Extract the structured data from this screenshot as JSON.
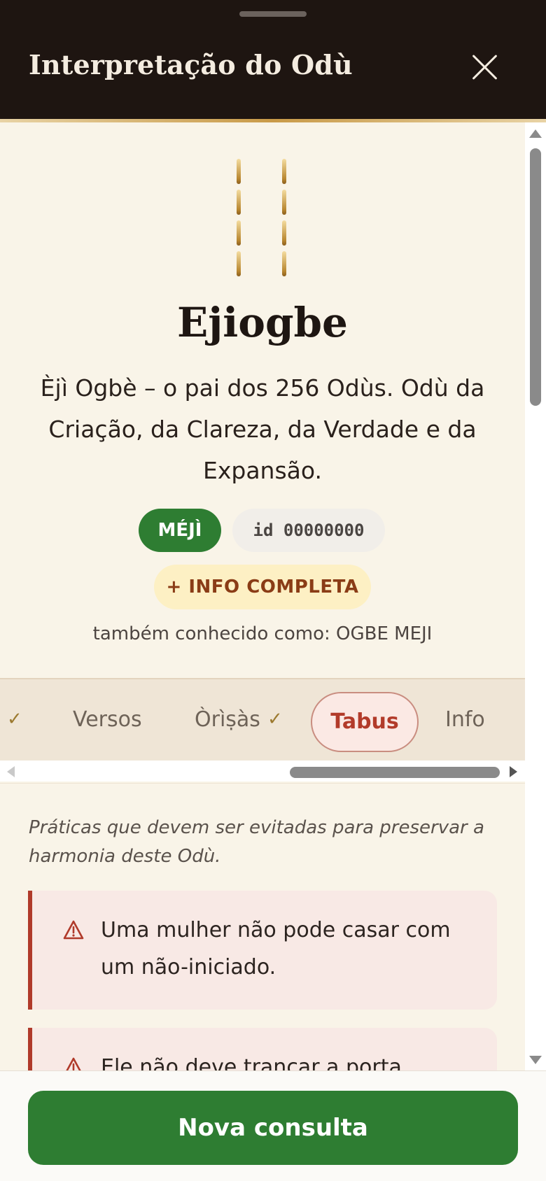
{
  "header": {
    "title": "Interpretação do Odù",
    "close_icon": "close-icon"
  },
  "odu": {
    "name": "Ejiogbe",
    "description": "Èjì Ogbè – o pai dos 256 Odùs. Odù da Criação, da Clareza, da Verdade e da Expansão.",
    "badge_meji": "MÉJÌ",
    "badge_id": "id 00000000",
    "info_button": "+ INFO COMPLETA",
    "aka": "também conhecido como: OGBE MEJI"
  },
  "tabs": {
    "items": [
      {
        "label": "Versos",
        "checked": false
      },
      {
        "label": "Òrìṣàs",
        "checked": true
      },
      {
        "label": "Tabus",
        "checked": false,
        "active": true
      },
      {
        "label": "Info",
        "checked": false
      }
    ],
    "check_glyph": "✓"
  },
  "tabus": {
    "intro": "Práticas que devem ser evitadas para preservar a harmonia deste Odù.",
    "items": [
      "Uma mulher não pode casar com um não-iniciado.",
      "Ele não deve trancar a porta"
    ]
  },
  "footer": {
    "primary_button": "Nova consulta"
  },
  "colors": {
    "header_bg": "#1e1511",
    "content_bg": "#f9f4e8",
    "accent_green": "#2e7d32",
    "tabu_red": "#b03a2a",
    "gold": "#c99a48"
  }
}
